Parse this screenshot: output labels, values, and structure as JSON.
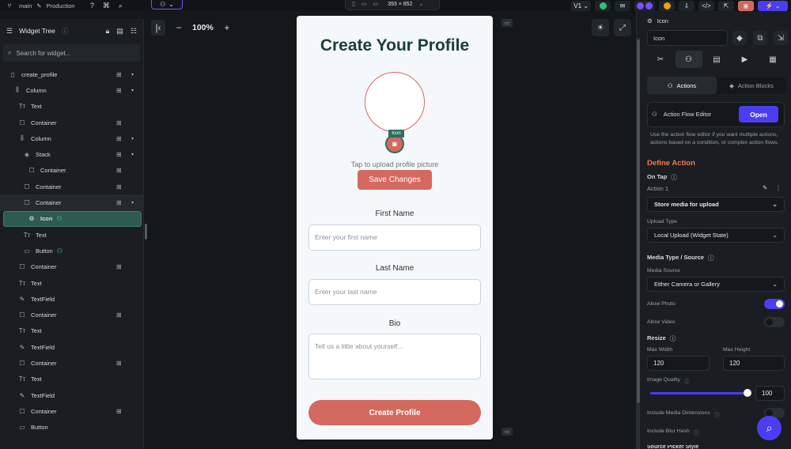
{
  "topbar": {
    "branch": "main",
    "environment": "Production",
    "device_size": "393 × 852",
    "version": "V1"
  },
  "left_panel": {
    "title": "Widget Tree",
    "search_placeholder": "Search for widget...",
    "tree": [
      {
        "label": "create_profile",
        "icon": "page-icon",
        "indent": 0,
        "add": true,
        "caret": true
      },
      {
        "label": "Column",
        "icon": "column-icon",
        "indent": 1,
        "add": true,
        "caret": true
      },
      {
        "label": "Text",
        "icon": "text-icon",
        "indent": 2,
        "add": false,
        "caret": false
      },
      {
        "label": "Container",
        "icon": "container-icon",
        "indent": 2,
        "add": true,
        "caret": false
      },
      {
        "label": "Column",
        "icon": "column-icon",
        "indent": 2,
        "add": true,
        "caret": true
      },
      {
        "label": "Stack",
        "icon": "stack-icon",
        "indent": 3,
        "add": true,
        "caret": true
      },
      {
        "label": "Container",
        "icon": "container-icon",
        "indent": 4,
        "add": true,
        "caret": false
      },
      {
        "label": "Container",
        "icon": "container-icon",
        "indent": 3,
        "add": true,
        "caret": false
      },
      {
        "label": "Container",
        "icon": "container-icon",
        "indent": 3,
        "add": true,
        "caret": true
      },
      {
        "label": "Icon",
        "icon": "settings-icon",
        "indent": 4,
        "add": false,
        "caret": false,
        "selected": true,
        "action": true
      },
      {
        "label": "Text",
        "icon": "text-icon",
        "indent": 3,
        "add": false,
        "caret": false
      },
      {
        "label": "Button",
        "icon": "button-icon",
        "indent": 3,
        "add": false,
        "caret": false,
        "action": true
      },
      {
        "label": "Container",
        "icon": "container-icon",
        "indent": 2,
        "add": true,
        "caret": false
      },
      {
        "label": "Text",
        "icon": "text-icon",
        "indent": 2,
        "add": false,
        "caret": false
      },
      {
        "label": "TextField",
        "icon": "textfield-icon",
        "indent": 2,
        "add": false,
        "caret": false
      },
      {
        "label": "Container",
        "icon": "container-icon",
        "indent": 2,
        "add": true,
        "caret": false
      },
      {
        "label": "Text",
        "icon": "text-icon",
        "indent": 2,
        "add": false,
        "caret": false
      },
      {
        "label": "TextField",
        "icon": "textfield-icon",
        "indent": 2,
        "add": false,
        "caret": false
      },
      {
        "label": "Container",
        "icon": "container-icon",
        "indent": 2,
        "add": true,
        "caret": false
      },
      {
        "label": "Text",
        "icon": "text-icon",
        "indent": 2,
        "add": false,
        "caret": false
      },
      {
        "label": "TextField",
        "icon": "textfield-icon",
        "indent": 2,
        "add": false,
        "caret": false
      },
      {
        "label": "Container",
        "icon": "container-icon",
        "indent": 2,
        "add": true,
        "caret": false
      },
      {
        "label": "Button",
        "icon": "button-icon",
        "indent": 2,
        "add": false,
        "caret": false
      }
    ]
  },
  "canvas": {
    "zoom": "100%"
  },
  "phone": {
    "title": "Create Your Profile",
    "icon_tag": "Icon",
    "tap_hint": "Tap to upload profile picture",
    "save_button": "Save Changes",
    "first_name_label": "First Name",
    "first_name_placeholder": "Enter your first name",
    "last_name_label": "Last Name",
    "last_name_placeholder": "Enter your last name",
    "bio_label": "Bio",
    "bio_placeholder": "Tell us a little about yourself...",
    "create_button": "Create Profile"
  },
  "right_panel": {
    "widget_type": "Icon",
    "widget_name": "Icon",
    "tab_actions": "Actions",
    "tab_action_blocks": "Action Blocks",
    "action_flow_title": "Action Flow Editor",
    "open_button": "Open",
    "action_flow_desc": "Use the action flow editor if you want multiple actions, actions based on a condition, or complex action flows.",
    "define_action": "Define Action",
    "on_tap": "On Tap",
    "action_1": "Action 1",
    "action_type": "Store media for upload",
    "upload_type_label": "Upload Type",
    "upload_type": "Local Upload (Widget State)",
    "media_type_label": "Media Type / Source",
    "media_source_label": "Media Source",
    "media_source": "Either Camera or Gallery",
    "allow_photo_label": "Allow Photo",
    "allow_photo": true,
    "allow_video_label": "Allow Video",
    "allow_video": false,
    "resize_label": "Resize",
    "max_width_label": "Max Width",
    "max_width": "120",
    "max_height_label": "Max Height",
    "max_height": "120",
    "image_quality_label": "Image Quality",
    "image_quality": "100",
    "include_dimensions_label": "Include Media Dimensions",
    "include_blur_label": "Include Blur Hash",
    "source_picker_label": "Source Picker Style"
  },
  "colors": {
    "accent": "#4b3df2",
    "brand_coral": "#d4695f",
    "brand_teal": "#1a3c3a",
    "define_action": "#f07a4f",
    "selection": "#2e5a4f"
  }
}
